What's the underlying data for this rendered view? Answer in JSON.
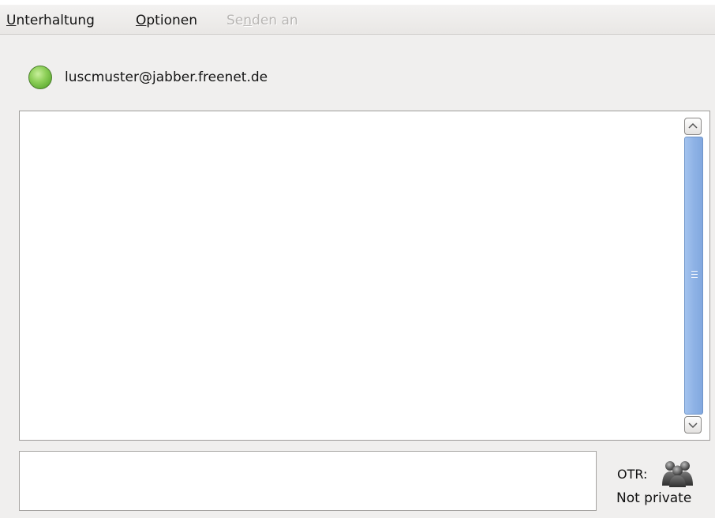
{
  "menubar": {
    "items": [
      {
        "label": "Unterhaltung",
        "enabled": true
      },
      {
        "label": "Optionen",
        "enabled": true
      },
      {
        "label": "Senden an",
        "enabled": false
      }
    ]
  },
  "contact": {
    "name": "luscmuster@jabber.freenet.de",
    "status_icon": "online-status-icon",
    "status_color": "#7cc24a"
  },
  "chat_view": {
    "scrollbar_thumb_color": "#8fb3e6"
  },
  "message_input": {
    "value": ""
  },
  "otr": {
    "label": "OTR:",
    "status": "Not private",
    "icon": "otr-not-private-icon"
  }
}
